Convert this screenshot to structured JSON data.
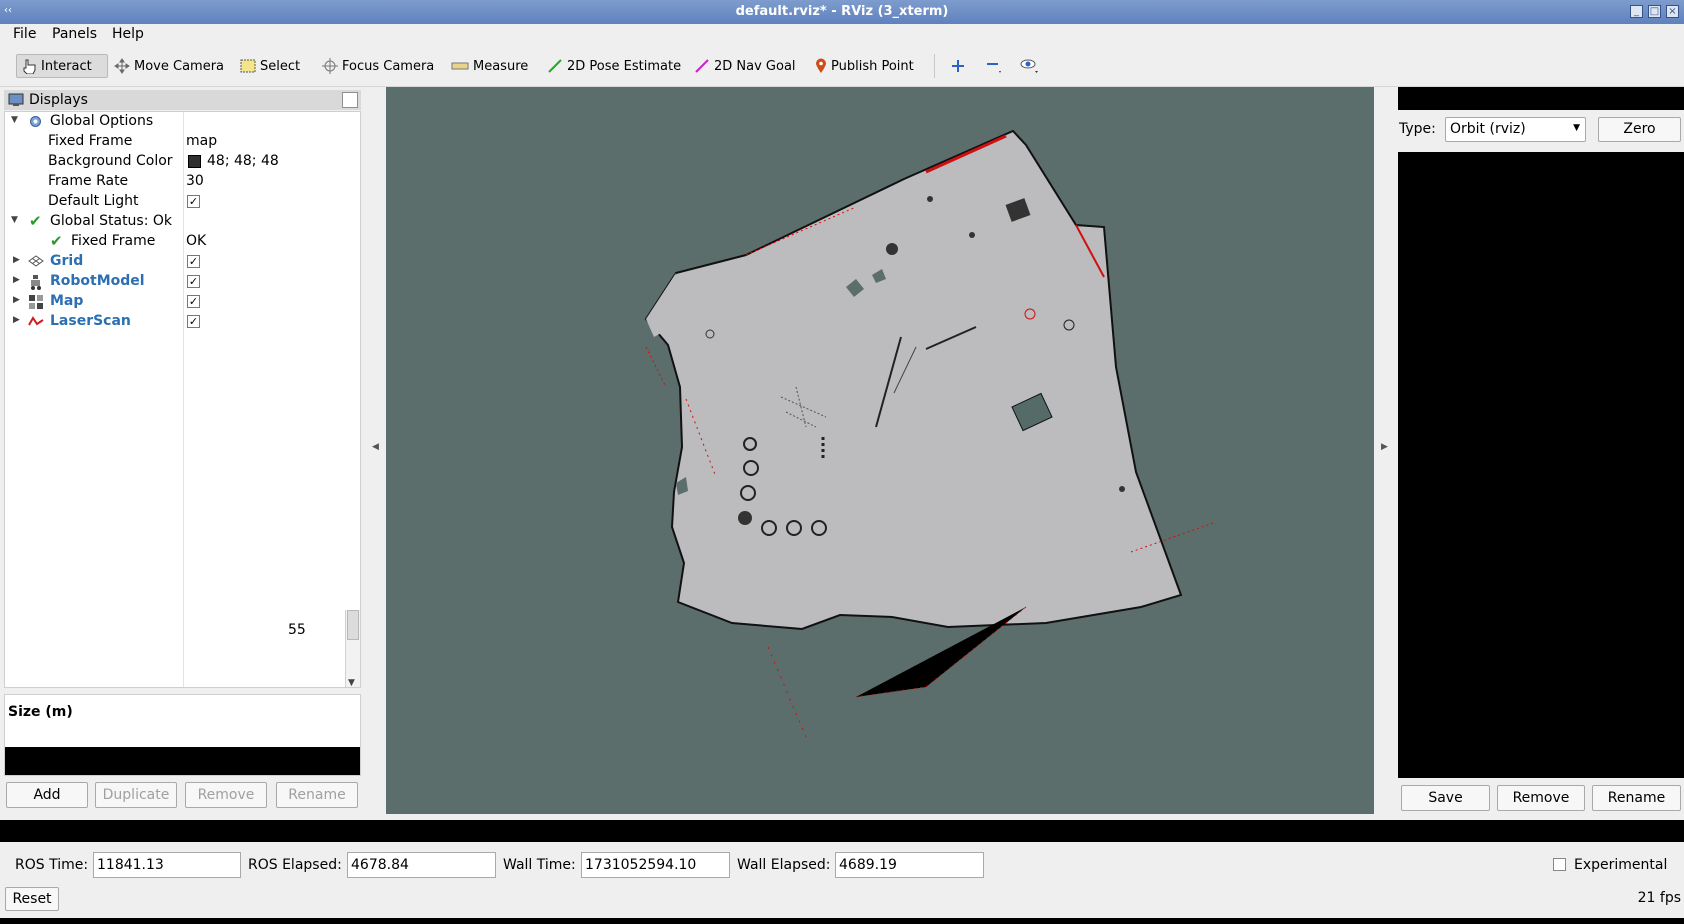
{
  "window": {
    "title": "default.rviz* - RViz (3_xterm)"
  },
  "menu": [
    "File",
    "Panels",
    "Help"
  ],
  "toolbar": {
    "interact": "Interact",
    "move_camera": "Move Camera",
    "select": "Select",
    "focus_camera": "Focus Camera",
    "measure": "Measure",
    "pose_estimate": "2D Pose Estimate",
    "nav_goal": "2D Nav Goal",
    "publish_point": "Publish Point"
  },
  "displays": {
    "title": "Displays",
    "global_options": "Global Options",
    "fixed_frame_label": "Fixed Frame",
    "fixed_frame_value": "map",
    "bg_color_label": "Background Color",
    "bg_color_value": "48; 48; 48",
    "frame_rate_label": "Frame Rate",
    "frame_rate_value": "30",
    "default_light_label": "Default Light",
    "global_status": "Global Status: Ok",
    "status_fixed_frame": "Fixed Frame",
    "status_fixed_frame_value": "OK",
    "grid": "Grid",
    "robot_model": "RobotModel",
    "map": "Map",
    "laser_scan": "LaserScan",
    "scroll_value": "55",
    "desc_text": "Size (m)"
  },
  "display_buttons": {
    "add": "Add",
    "duplicate": "Duplicate",
    "remove": "Remove",
    "rename": "Rename"
  },
  "views": {
    "type_label": "Type:",
    "type_value": "Orbit (rviz)",
    "zero": "Zero",
    "save": "Save",
    "remove": "Remove",
    "rename": "Rename"
  },
  "time": {
    "ros_time_label": "ROS Time:",
    "ros_time": "11841.13",
    "ros_elapsed_label": "ROS Elapsed:",
    "ros_elapsed": "4678.84",
    "wall_time_label": "Wall Time:",
    "wall_time": "1731052594.10",
    "wall_elapsed_label": "Wall Elapsed:",
    "wall_elapsed": "4689.19",
    "experimental": "Experimental",
    "reset": "Reset",
    "fps": "21 fps"
  },
  "colors": {
    "viewport": "#5c6e6b",
    "map_free": "#bcbcbe",
    "laser": "#e01010",
    "link_blue": "#2c6fb3"
  }
}
